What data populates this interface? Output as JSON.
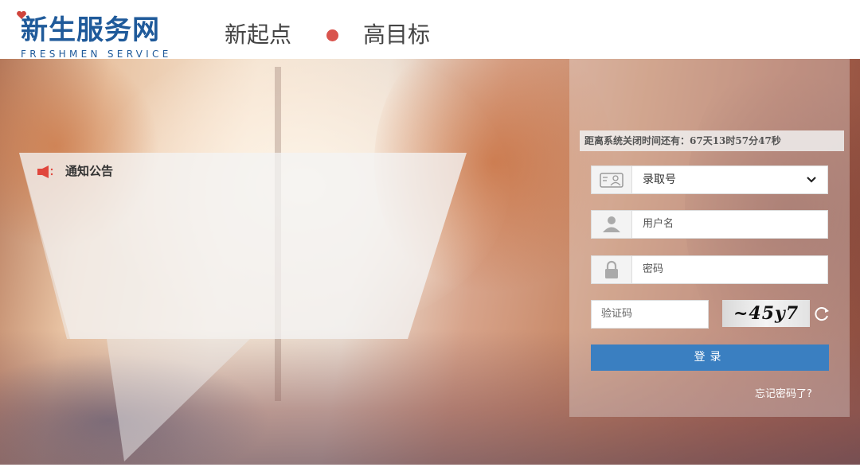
{
  "header": {
    "logo_title": "新生服务网",
    "logo_subtitle": "FRESHMEN SERVICE",
    "slogan_left": "新起点",
    "slogan_right": "高目标",
    "dot_color": "#d9544d",
    "brand_color": "#1f5a9a"
  },
  "notice": {
    "title": "通知公告",
    "icon": "speaker-icon"
  },
  "login": {
    "countdown": "距离系统关闭时间还有：67天13时57分47秒",
    "id_type_selected": "录取号",
    "username_placeholder": "用户名",
    "password_placeholder": "密码",
    "captcha_placeholder": "验证码",
    "captcha_code": "~45y7",
    "login_button": "登录",
    "forgot_link": "忘记密码了?",
    "button_color": "#3a7fc1"
  }
}
